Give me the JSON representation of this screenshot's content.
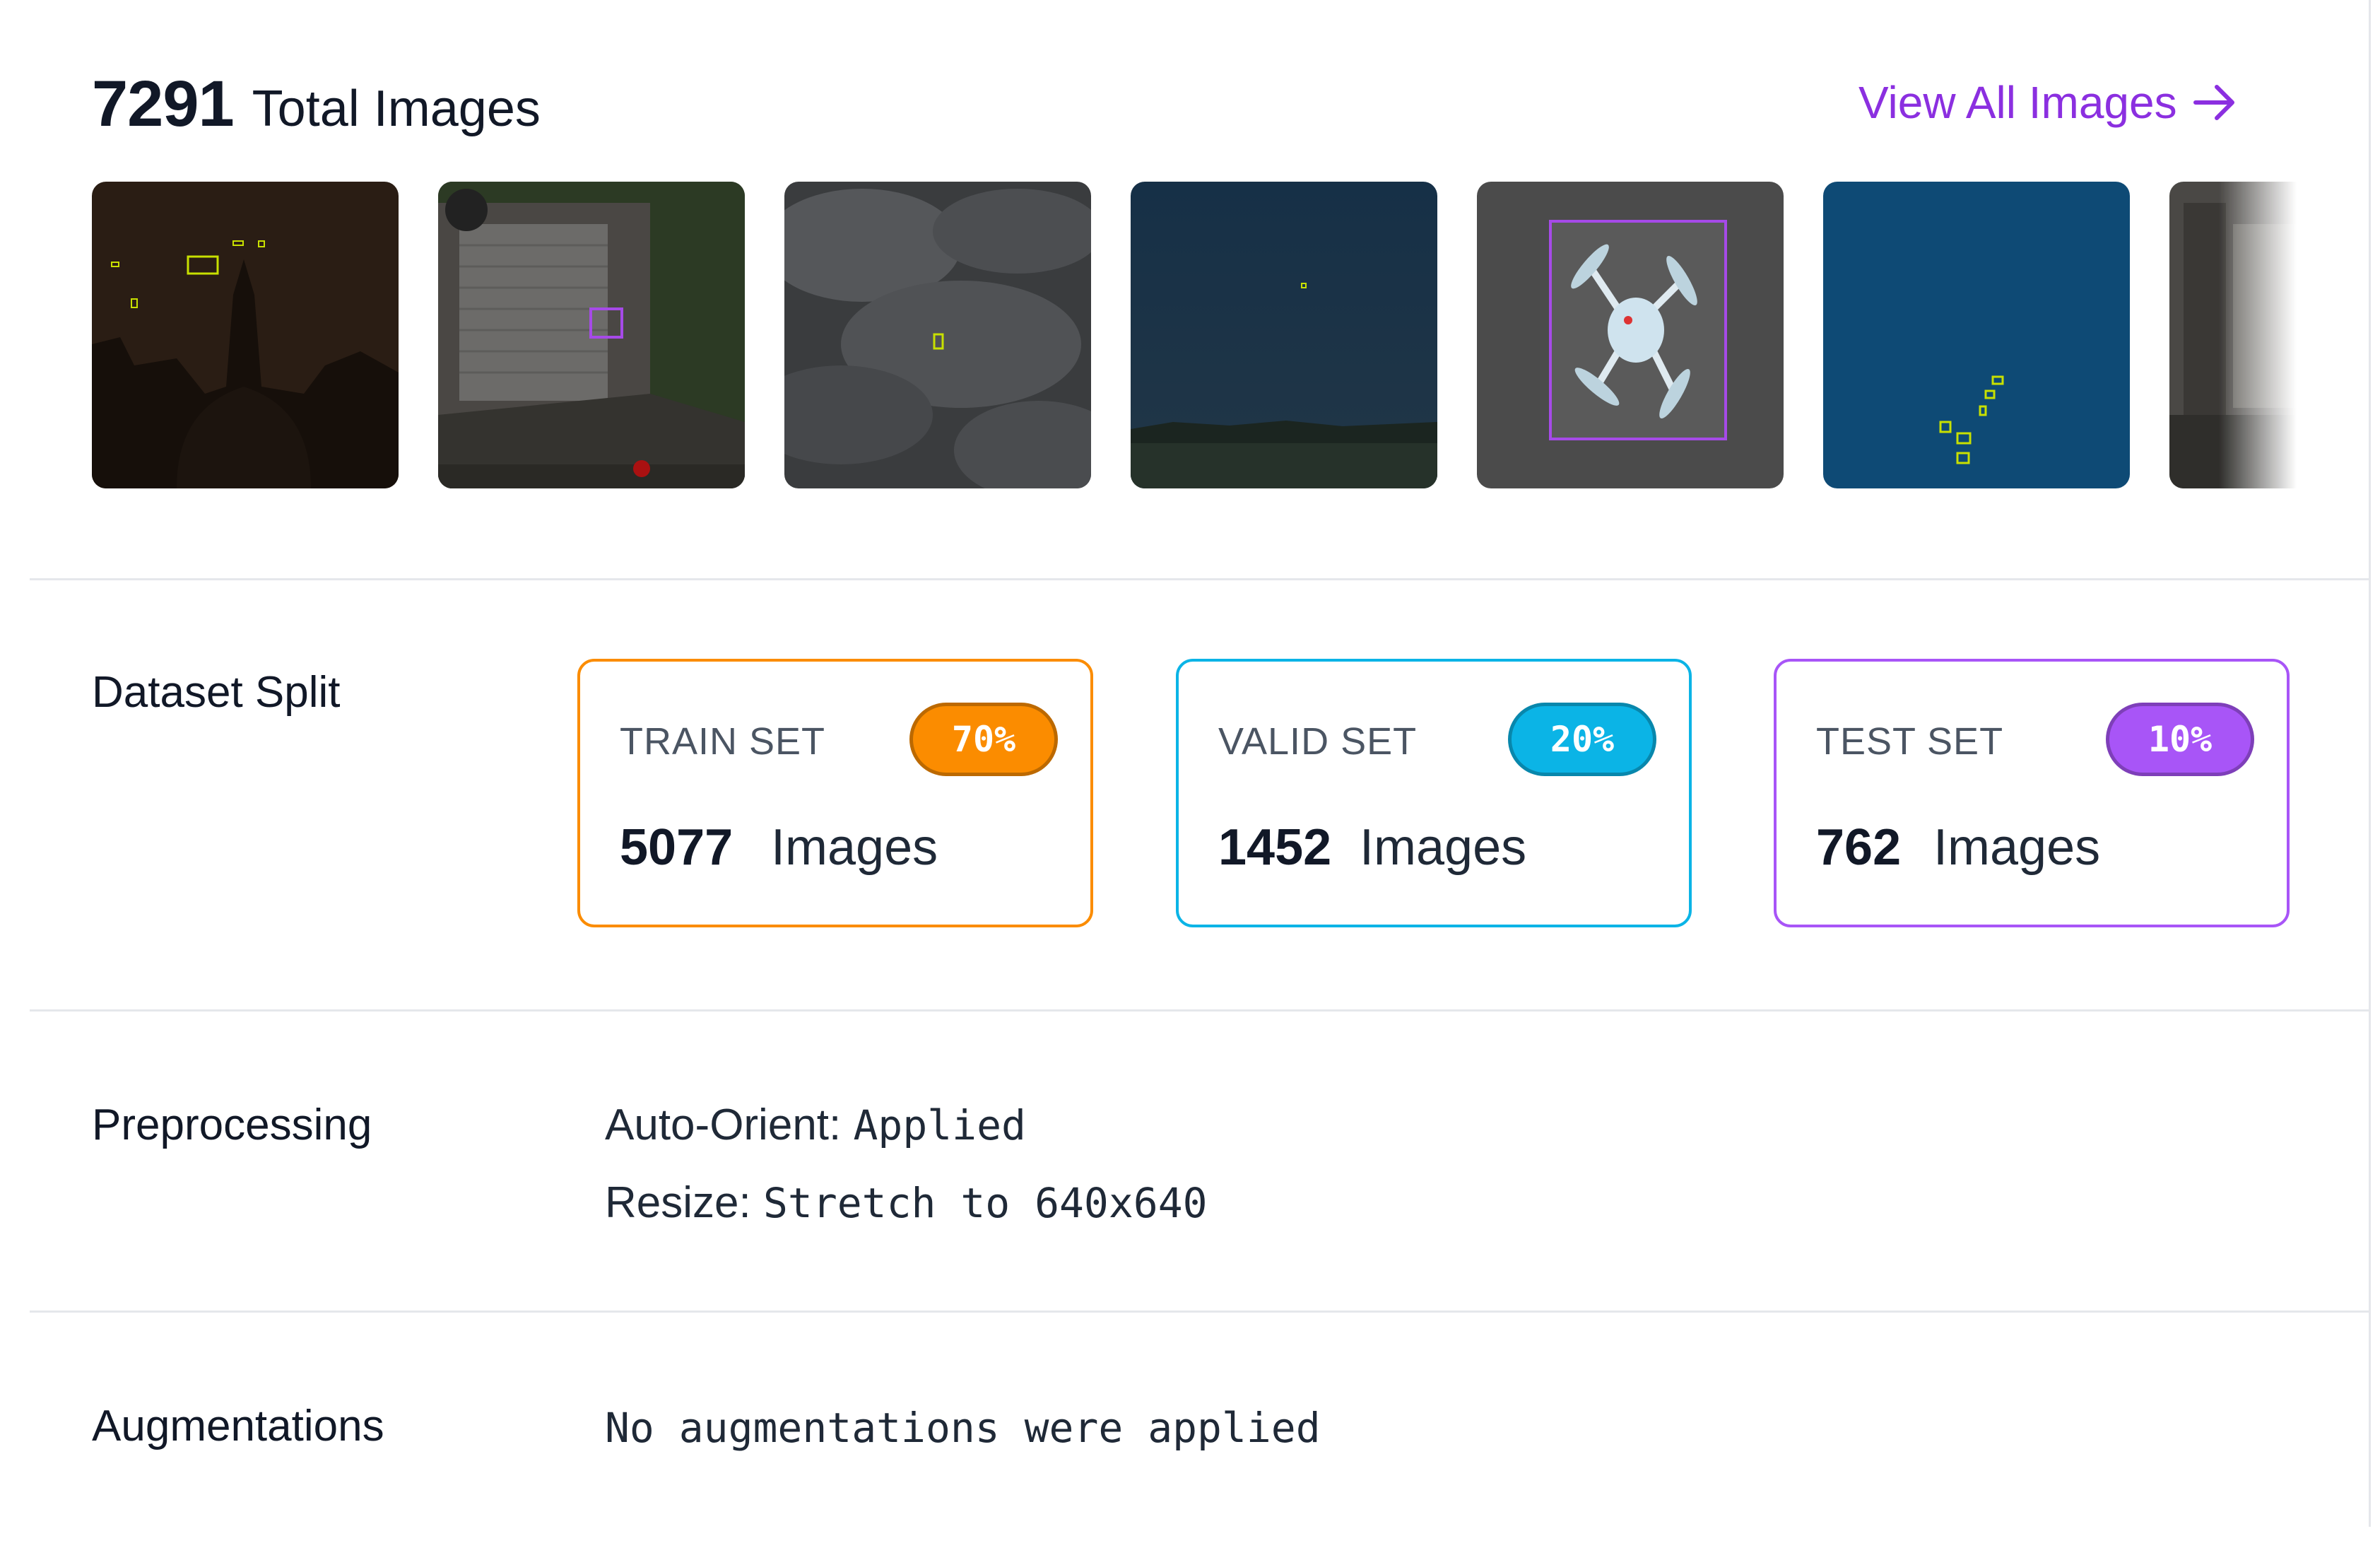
{
  "header": {
    "total_count": "7291",
    "total_label": "Total Images",
    "view_all_label": "View All Images"
  },
  "thumbnails": [
    {
      "name": "thumb-dusk-tower"
    },
    {
      "name": "thumb-garage-door"
    },
    {
      "name": "thumb-clouds"
    },
    {
      "name": "thumb-night-sky"
    },
    {
      "name": "thumb-drone-closeup"
    },
    {
      "name": "thumb-blue-sky"
    },
    {
      "name": "thumb-partial"
    }
  ],
  "dataset_split": {
    "label": "Dataset Split",
    "train": {
      "title": "TRAIN SET",
      "percent": "70%",
      "count": "5077",
      "unit": "Images",
      "color": "#fb8c00"
    },
    "valid": {
      "title": "VALID SET",
      "percent": "20%",
      "count": "1452",
      "unit": "Images",
      "color": "#0bb4e6"
    },
    "test": {
      "title": "TEST SET",
      "percent": "10%",
      "count": "762",
      "unit": "Images",
      "color": "#a855f7"
    }
  },
  "preprocessing": {
    "label": "Preprocessing",
    "items": [
      {
        "key": "Auto-Orient:",
        "value": "Applied"
      },
      {
        "key": "Resize:",
        "value": "Stretch to 640x640"
      }
    ]
  },
  "augmentations": {
    "label": "Augmentations",
    "value": "No augmentations were applied"
  },
  "colors": {
    "accent": "#8b2fe0",
    "divider": "#e5e7eb"
  }
}
